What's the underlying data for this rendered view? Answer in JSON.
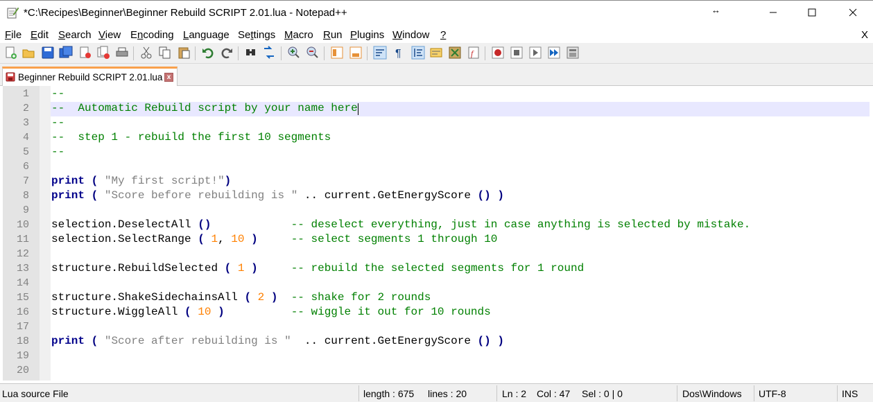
{
  "window": {
    "title": "*C:\\Recipes\\Beginner\\Beginner Rebuild SCRIPT 2.01.lua - Notepad++"
  },
  "menu": [
    {
      "label": "File",
      "u": "F",
      "rest": "ile"
    },
    {
      "label": "Edit",
      "u": "E",
      "rest": "dit"
    },
    {
      "label": "Search",
      "u": "S",
      "rest": "earch"
    },
    {
      "label": "View",
      "u": "V",
      "rest": "iew"
    },
    {
      "label": "Encoding",
      "pre": "E",
      "u": "n",
      "rest": "coding"
    },
    {
      "label": "Language",
      "u": "L",
      "rest": "anguage"
    },
    {
      "label": "Settings",
      "pre": "Se",
      "u": "t",
      "rest": "tings"
    },
    {
      "label": "Macro",
      "u": "M",
      "rest": "acro"
    },
    {
      "label": "Run",
      "u": "R",
      "rest": "un"
    },
    {
      "label": "Plugins",
      "u": "P",
      "rest": "lugins"
    },
    {
      "label": "Window",
      "u": "W",
      "rest": "indow"
    },
    {
      "label": "?",
      "u": "?",
      "rest": ""
    }
  ],
  "menu_close": "X",
  "tab": {
    "label": "Beginner Rebuild SCRIPT 2.01.lua",
    "close": "x"
  },
  "editor": {
    "line_numbers": [
      "1",
      "2",
      "3",
      "4",
      "5",
      "6",
      "7",
      "8",
      "9",
      "10",
      "11",
      "12",
      "13",
      "14",
      "15",
      "16",
      "17",
      "18",
      "19",
      "20"
    ],
    "current_line": 2,
    "lines": [
      "--",
      "--  Automatic Rebuild script by your name here",
      "--",
      "--  step 1 - rebuild the first 10 segments",
      "--",
      "",
      "print ( \"My first script!\")",
      "print ( \"Score before rebuilding is \" .. current.GetEnergyScore () )",
      "",
      "selection.DeselectAll ()            -- deselect everything, just in case anything is selected by mistake.",
      "selection.SelectRange ( 1, 10 )     -- select segments 1 through 10",
      "",
      "structure.RebuildSelected ( 1 )     -- rebuild the selected segments for 1 round",
      "",
      "structure.ShakeSidechainsAll ( 2 )  -- shake for 2 rounds",
      "structure.WiggleAll ( 10 )          -- wiggle it out for 10 rounds",
      "",
      "print ( \"Score after rebuilding is \"  .. current.GetEnergyScore () )",
      "",
      ""
    ]
  },
  "status": {
    "file_type": "Lua source File",
    "length": "length : 675",
    "lines": "lines : 20",
    "ln": "Ln : 2",
    "col": "Col : 47",
    "sel": "Sel : 0 | 0",
    "eol": "Dos\\Windows",
    "encoding": "UTF-8",
    "mode": "INS"
  },
  "colors": {
    "comment": "#008000",
    "keyword": "#00008b",
    "string": "#808080",
    "number": "#ff8000",
    "current_line": "#e8e8ff",
    "tab_accent": "#f9a04c"
  }
}
